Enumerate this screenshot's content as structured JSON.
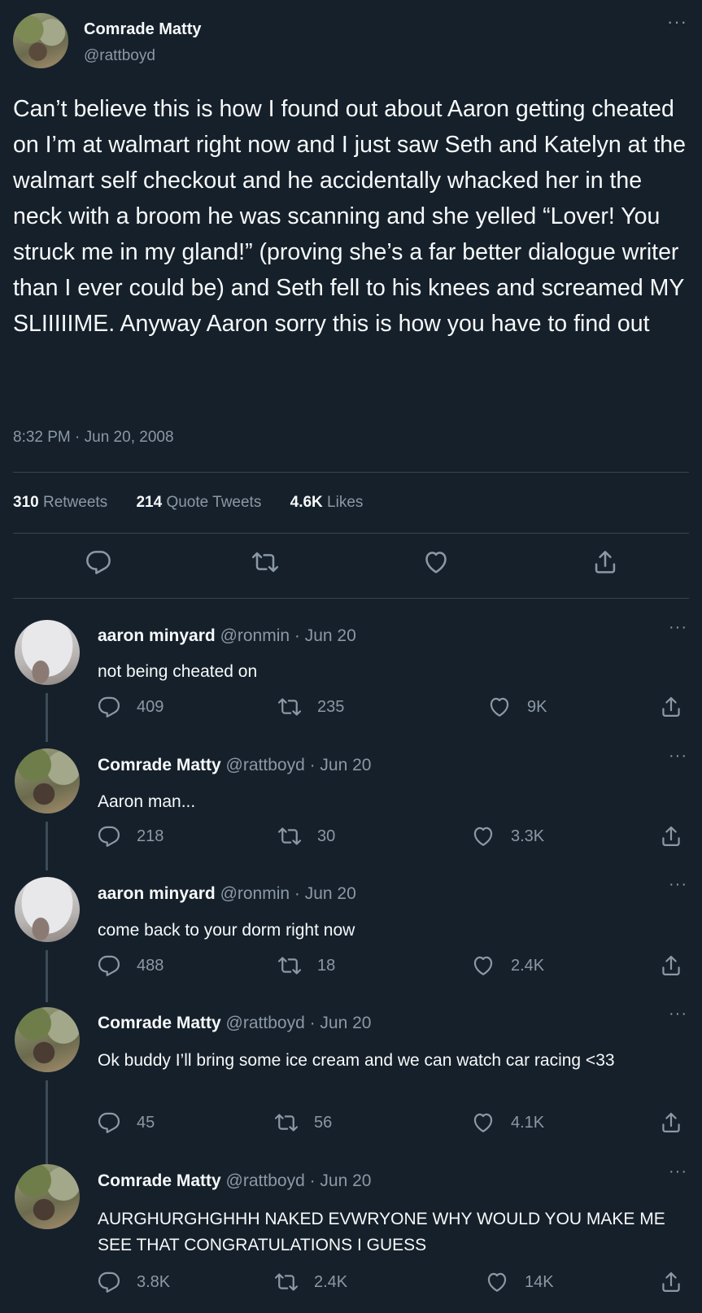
{
  "main_tweet": {
    "display_name": "Comrade Matty",
    "handle": "@rattboyd",
    "text": "Can’t believe this is how I found out about Aaron getting cheated on I’m at walmart right now and I just saw Seth and Katelyn at the walmart self checkout and he accidentally whacked her in the neck with a broom he was scanning and she yelled “Lover! You struck me in my gland!” (proving she’s a far better dialogue writer than I ever could be) and Seth fell to his knees and screamed MY SLIIIIIME. Anyway Aaron sorry this is how you have to find out",
    "timestamp": "8:32 PM · Jun 20, 2008",
    "stats": {
      "retweets_count": "310",
      "retweets_label": "Retweets",
      "quotes_count": "214",
      "quotes_label": "Quote Tweets",
      "likes_count": "4.6K",
      "likes_label": "Likes"
    },
    "more": "···"
  },
  "replies": [
    {
      "display_name": "aaron minyard",
      "meta": "@ronmin · Jun 20",
      "text": "not being cheated on",
      "replies": "409",
      "retweets": "235",
      "likes": "9K",
      "more": "···"
    },
    {
      "display_name": "Comrade Matty",
      "meta": "@rattboyd · Jun 20",
      "text": "Aaron man...",
      "replies": "218",
      "retweets": "30",
      "likes": "3.3K",
      "more": "···"
    },
    {
      "display_name": "aaron minyard",
      "meta": "@ronmin · Jun 20",
      "text": "come back to your dorm right now",
      "replies": "488",
      "retweets": "18",
      "likes": "2.4K",
      "more": "···"
    },
    {
      "display_name": "Comrade Matty",
      "meta": "@rattboyd · Jun 20",
      "text": "Ok buddy I’ll bring some ice cream and we can watch car racing <33",
      "replies": "45",
      "retweets": "56",
      "likes": "4.1K",
      "more": "···"
    },
    {
      "display_name": "Comrade Matty",
      "meta": "@rattboyd · Jun 20",
      "text": "AURGHURGHGHHH NAKED EVWRYONE WHY WOULD YOU MAKE ME SEE THAT CONGRATULATIONS I GUESS",
      "replies": "3.8K",
      "retweets": "2.4K",
      "likes": "14K",
      "more": "···"
    }
  ],
  "icons": {
    "reply": "reply-icon",
    "retweet": "retweet-icon",
    "like": "heart-icon",
    "share": "share-icon",
    "more": "more-icon"
  },
  "colors": {
    "background": "#15202b",
    "text": "#f7f9f9",
    "secondary": "#8b98a5",
    "divider": "#38444d"
  }
}
